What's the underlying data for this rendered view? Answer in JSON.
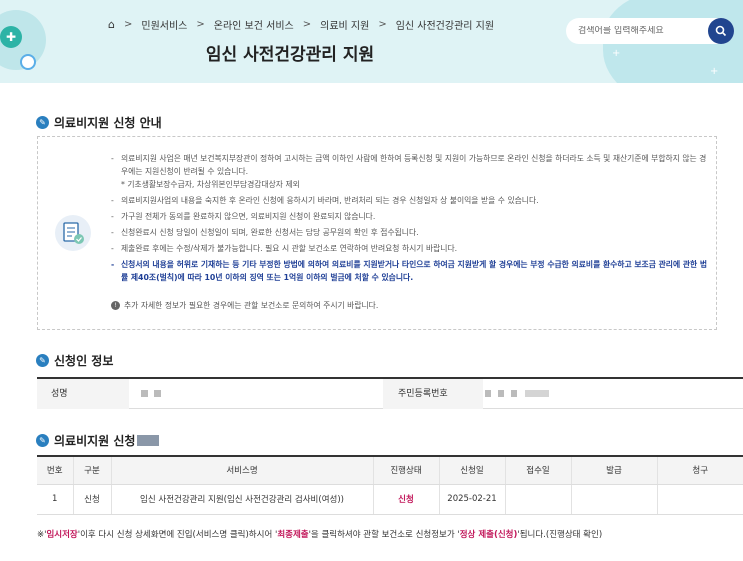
{
  "breadcrumb": {
    "items": [
      "민원서비스",
      "온라인 보건 서비스",
      "의료비 지원",
      "임신 사전건강관리 지원"
    ]
  },
  "page_title": "임신 사전건강관리 지원",
  "search": {
    "placeholder": "검색어를 입력해주세요"
  },
  "notice": {
    "title": "의료비지원 신청 안내",
    "items": [
      "의료비지원 사업은 매년 보건복지부장관이 정하여 고시하는 금액 이하인 사람에 한하여 등록신청 및 지원이 가능하므로 온라인 신청을 하더라도 소득 및 재산기준에 부합하지 않는 경우에는 지원신청이 반려될 수 있습니다.",
      "* 기초생활보장수급자, 차상위본인부담경감대상자 제외",
      "의료비지원사업의 내용을 숙지한 후 온라인 신청에 응하시기 바라며, 반려처리 되는 경우 신청일자 상 불이익을 받을 수 있습니다.",
      "가구원 전체가 동의를 완료하지 않으면, 의료비지원 신청이 완료되지 않습니다.",
      "신청완료시 신청 당일이 신청일이 되며, 완료한 신청서는 담당 공무원의 확인 후 접수됩니다.",
      "제출완료 후에는 수정/삭제가 불가능합니다. 필요 시 관할 보건소로 연락하여 반려요청 하시기 바랍니다.",
      "신청서의 내용을 허위로 기재하는 등 기타 부정한 방법에 의하여 의료비를 지원받거나 타인으로 하여금 지원받게 할 경우에는 부정 수급한 의료비를 환수하고 보조금 관리에 관한 법률 제40조(벌칙)에 따라 10년 이하의 징역 또는 1억원 이하의 벌금에 처할 수 있습니다."
    ],
    "info": "추가 자세한 정보가 필요한 경우에는 관할 보건소로 문의하여 주시기 바랍니다."
  },
  "applicant": {
    "title": "신청인 정보",
    "name_label": "성명",
    "rrn_label": "주민등록번호"
  },
  "applications": {
    "title": "의료비지원 신청",
    "headers": [
      "번호",
      "구분",
      "서비스명",
      "진행상태",
      "신청일",
      "접수일",
      "발급",
      "청구"
    ],
    "rows": [
      {
        "no": "1",
        "type": "신청",
        "service": "임신 사전건강관리 지원(임신 사전건강관리 검사비(여성))",
        "status": "신청",
        "applied": "2025-02-21",
        "received": "",
        "issued": "",
        "claim": ""
      }
    ]
  },
  "footnote": {
    "p1": "※'",
    "e1": "임시저장",
    "p2": "'이후 다시 신청 상세화면에 진입(서비스명 클릭)하시어 '",
    "e2": "최종제출",
    "p3": "'을 클릭하셔야 관할 보건소로 신청정보가 '",
    "e3": "정상 제출(신청)",
    "p4": "'됩니다.(진행상태 확인)"
  },
  "colors": {
    "accent": "#21458f",
    "status": "#c2185b",
    "banner": "#dff3f5"
  },
  "icons": [
    "home-icon",
    "search-icon",
    "document-check-icon",
    "info-icon",
    "section-check-icon"
  ]
}
